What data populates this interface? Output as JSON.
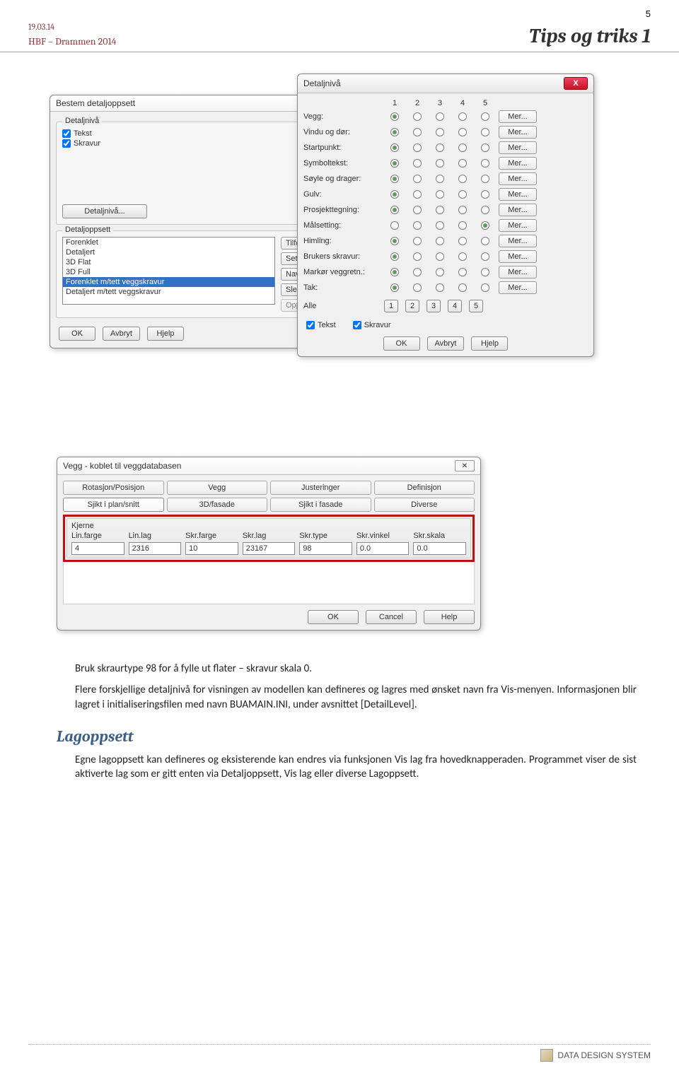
{
  "header": {
    "date": "19.03.14",
    "sub": "HBF – Drammen 2014",
    "page": "5",
    "title": "Tips og triks 1"
  },
  "bestem": {
    "title": "Bestem detaljoppsett",
    "grp1": "Detaljnivå",
    "chk_tekst": "Tekst",
    "chk_skravur": "Skravur",
    "btn_detalj": "Detaljnivå...",
    "grp2": "Detaljoppsett",
    "list": [
      "Forenklet",
      "Detaljert",
      "3D Flat",
      "3D Full",
      "Forenklet m/tett veggskravur",
      "Detaljert m/tett veggskravur"
    ],
    "sidebtns": [
      "Tilføy",
      "Sett in",
      "Navn",
      "Slet",
      "Oppda"
    ],
    "btn_ok": "OK",
    "btn_av": "Avbryt",
    "btn_hj": "Hjelp"
  },
  "detalj": {
    "title": "Detaljnivå",
    "cols": [
      "1",
      "2",
      "3",
      "4",
      "5"
    ],
    "rows": [
      {
        "label": "Vegg:",
        "sel": 0
      },
      {
        "label": "Vindu og dør:",
        "sel": 0
      },
      {
        "label": "Startpunkt:",
        "sel": 0
      },
      {
        "label": "Symboltekst:",
        "sel": 0
      },
      {
        "label": "Søyle og drager:",
        "sel": 0
      },
      {
        "label": "Gulv:",
        "sel": 0
      },
      {
        "label": "Prosjekttegning:",
        "sel": 0
      },
      {
        "label": "Målsetting:",
        "sel": 4
      },
      {
        "label": "Himling:",
        "sel": 0
      },
      {
        "label": "Brukers skravur:",
        "sel": 0
      },
      {
        "label": "Markør veggretn.:",
        "sel": 0
      },
      {
        "label": "Tak:",
        "sel": 0
      }
    ],
    "mer": "Mer...",
    "alle": "Alle",
    "chk_tekst": "Tekst",
    "chk_skravur": "Skravur",
    "btn_ok": "OK",
    "btn_av": "Avbryt",
    "btn_hj": "Hjelp"
  },
  "vegg": {
    "title": "Vegg - koblet til veggdatabasen",
    "tabs_top": [
      "Rotasjon/Posisjon",
      "Vegg",
      "Justeringer",
      "Definisjon"
    ],
    "tabs_bot": [
      "Sjikt i plan/snitt",
      "3D/fasade",
      "Sjikt i fasade",
      "Diverse"
    ],
    "kjerne": "Kjerne",
    "cols": [
      "Lin.farge",
      "Lin.lag",
      "Skr.farge",
      "Skr.lag",
      "Skr.type",
      "Skr.vinkel",
      "Skr.skala"
    ],
    "vals": [
      "4",
      "2316",
      "10",
      "23167",
      "98",
      "0.0",
      "0.0"
    ],
    "btn_ok": "OK",
    "btn_ca": "Cancel",
    "btn_he": "Help"
  },
  "body": {
    "p1": "Bruk skraurtype 98 for å fylle ut flater – skravur skala 0.",
    "p2": "Flere forskjellige detaljnivå for visningen av modellen kan defineres og lagres med ønsket navn fra Vis-menyen. Informasjonen blir lagret i initialiseringsfilen med navn BUAMAIN.INI, under avsnittet [DetailLevel].",
    "h2": "Lagoppsett",
    "p3": "Egne lagoppsett kan defineres og eksisterende kan endres via funksjonen Vis lag fra hovedknapperaden. Programmet viser de sist aktiverte lag som er gitt enten via Detaljoppsett, Vis lag eller diverse Lagoppsett."
  },
  "footer": {
    "brand1": "DATA ",
    "brand2": "DESIGN ",
    "brand3": "SYSTEM"
  }
}
